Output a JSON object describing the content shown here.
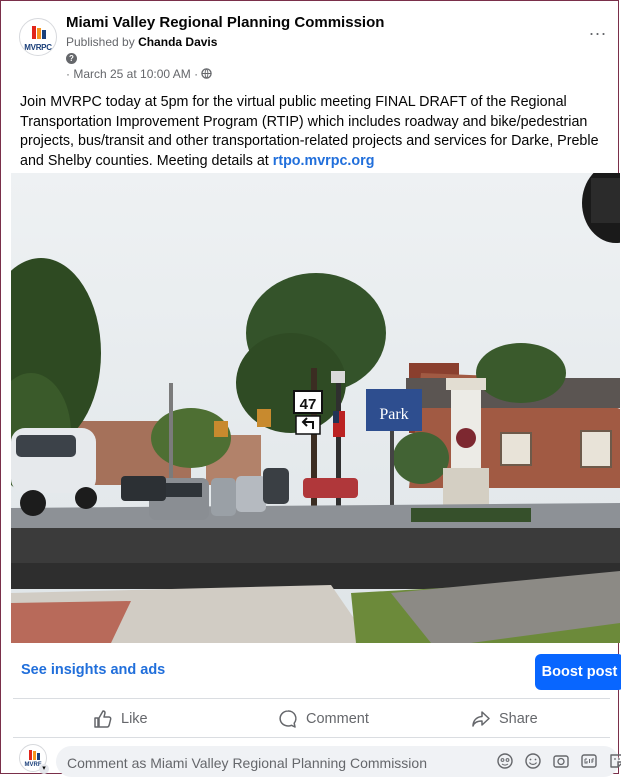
{
  "post": {
    "page_name": "Miami Valley Regional Planning Commission",
    "logo_text": "MVRPC",
    "published_prefix": "Published by",
    "publisher": "Chanda Davis",
    "help_icon_glyph": "?",
    "timestamp": "· March 25 at 10:00 AM ·",
    "audience_icon": "globe-icon",
    "more_label": "...",
    "text": "Join MVRPC today at 5pm for the virtual public meeting FINAL DRAFT of the Regional Transportation Improvement Program (RTIP) which includes roadway and bike/pedestrian projects, bus/transit and other transportation-related projects and services for Darke, Preble and Shelby counties. Meeting details at ",
    "link_text": "rtpo.mvrpc.org"
  },
  "photo": {
    "route_sign": "47",
    "park_sign": "Park"
  },
  "footer": {
    "insights_label": "See insights and ads",
    "boost_label": "Boost post"
  },
  "actions": {
    "like": "Like",
    "comment": "Comment",
    "share": "Share"
  },
  "comment": {
    "placeholder": "Comment as Miami Valley Regional Planning Commission",
    "avatar_text": "MVRF",
    "icons": [
      "avatar-sticker-icon",
      "emoji-icon",
      "camera-icon",
      "gif-icon",
      "sticker-icon"
    ]
  },
  "colors": {
    "accent": "#0866ff",
    "link": "#216fdb",
    "border": "#7a2f4a"
  }
}
